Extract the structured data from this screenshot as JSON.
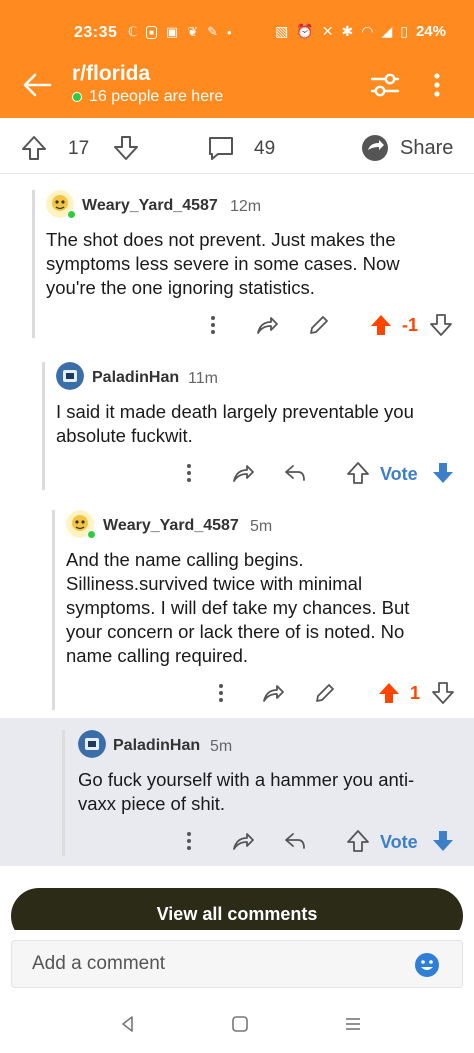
{
  "status_bar": {
    "time": "23:35",
    "battery": "24%"
  },
  "header": {
    "subreddit": "r/florida",
    "online": "16 people are here"
  },
  "post_actions": {
    "score": "17",
    "comment_count": "49",
    "share_label": "Share"
  },
  "comments": [
    {
      "author": "Weary_Yard_4587",
      "time": "12m",
      "body": "The shot does not prevent. Just makes the symptoms less severe in some cases.  Now you're the one ignoring statistics.",
      "score": "-1",
      "voted": "up"
    },
    {
      "author": "PaladinHan",
      "time": "11m",
      "body": "I said it made death largely preventable you absolute fuckwit.",
      "vote_label": "Vote"
    },
    {
      "author": "Weary_Yard_4587",
      "time": "5m",
      "body": "And the name calling begins. Silliness.survived twice with minimal symptoms. I will def take my chances. But your concern or lack there of is noted.  No name calling required.",
      "score": "1",
      "voted": "up"
    },
    {
      "author": "PaladinHan",
      "time": "5m",
      "body": "Go fuck yourself with a hammer you anti-vaxx piece of shit.",
      "vote_label": "Vote"
    }
  ],
  "view_all_label": "View all comments",
  "composer": {
    "placeholder": "Add a comment"
  },
  "colors": {
    "header_bg": "#ff8a1f",
    "upvote": "#ff4500",
    "vote_blue": "#3d7fc8",
    "highlight_bg": "#e8eaf0",
    "view_all_bg": "#2b2b17"
  },
  "icons": [
    "back-arrow-icon",
    "filter-icon",
    "more-vertical-icon",
    "upvote-icon",
    "downvote-icon",
    "comment-icon",
    "share-icon",
    "reply-icon",
    "emoji-icon"
  ]
}
